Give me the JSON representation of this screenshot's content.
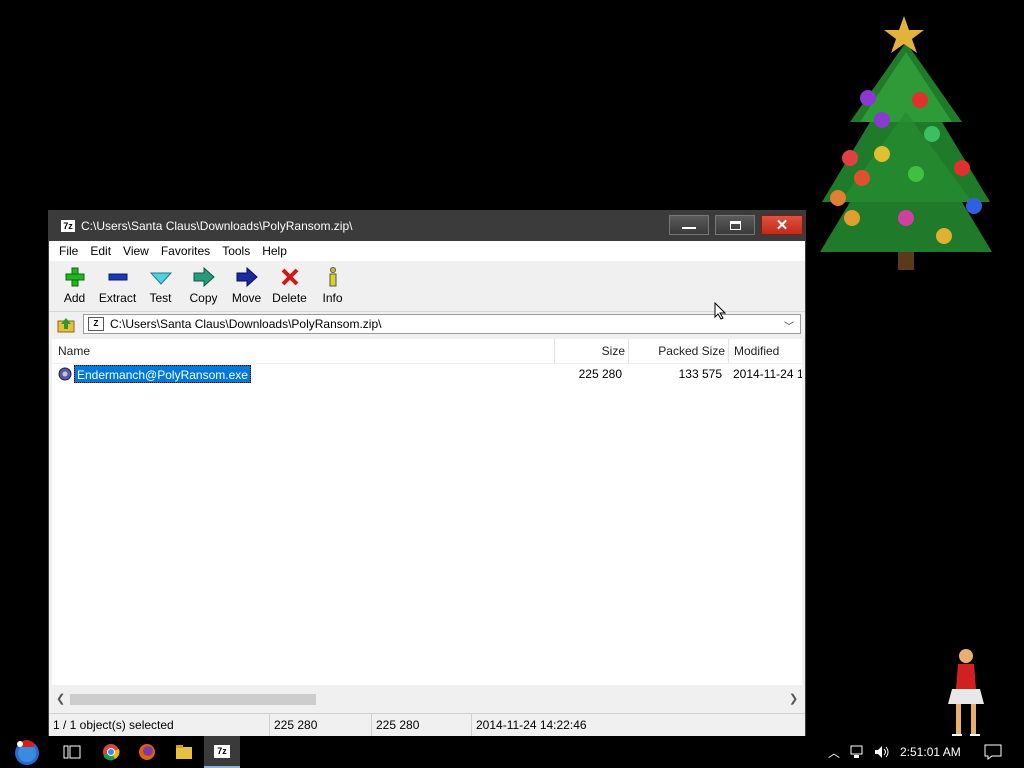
{
  "window": {
    "title": "C:\\Users\\Santa Claus\\Downloads\\PolyRansom.zip\\",
    "app_icon_text": "7z"
  },
  "menu": [
    "File",
    "Edit",
    "View",
    "Favorites",
    "Tools",
    "Help"
  ],
  "toolbar": {
    "add": "Add",
    "extract": "Extract",
    "test": "Test",
    "copy": "Copy",
    "move": "Move",
    "delete": "Delete",
    "info": "Info"
  },
  "address": {
    "path": "C:\\Users\\Santa Claus\\Downloads\\PolyRansom.zip\\"
  },
  "columns": {
    "name": "Name",
    "size": "Size",
    "packed_size": "Packed Size",
    "modified": "Modified"
  },
  "files": [
    {
      "name": "Endermanch@PolyRansom.exe",
      "size": "225 280",
      "packed_size": "133 575",
      "modified": "2014-11-24 1"
    }
  ],
  "status": {
    "selection": "1 / 1 object(s) selected",
    "size": "225 280",
    "size2": "225 280",
    "modified": "2014-11-24 14:22:46"
  },
  "taskbar": {
    "clock": "2:51:01 AM"
  },
  "colors": {
    "selection": "#0078d7",
    "titlebar": "#3b3b3b",
    "close_button": "#d0402f"
  }
}
